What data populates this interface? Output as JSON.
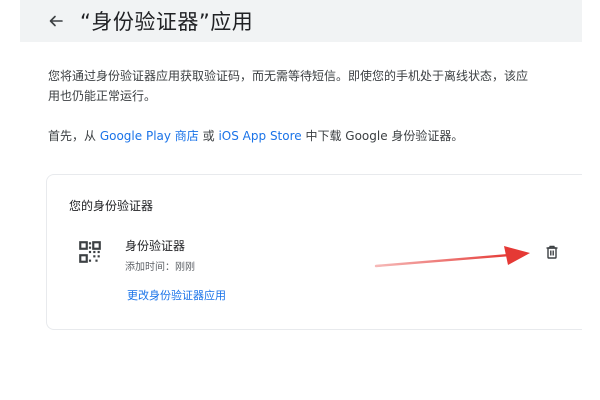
{
  "header": {
    "title": "“身份验证器”应用",
    "back_icon": "arrow-left-icon"
  },
  "intro": {
    "description": "您将通过身份验证器应用获取验证码，而无需等待短信。即使您的手机处于离线状态，该应用也仍能正常运行。",
    "download_prefix": "首先，从 ",
    "google_play_link": "Google Play 商店",
    "or_text": "或 ",
    "app_store_link": "iOS App Store",
    "download_suffix": " 中下载 Google 身份验证器。"
  },
  "card": {
    "title": "您的身份验证器",
    "authenticator": {
      "icon": "qr-code-icon",
      "name": "身份验证器",
      "added_time": "添加时间：刚刚"
    },
    "change_link": "更改身份验证器应用",
    "delete_icon": "trash-icon"
  },
  "colors": {
    "link": "#1a73e8",
    "header_bg": "#f1f3f4",
    "annotation_arrow": "#e53935"
  }
}
